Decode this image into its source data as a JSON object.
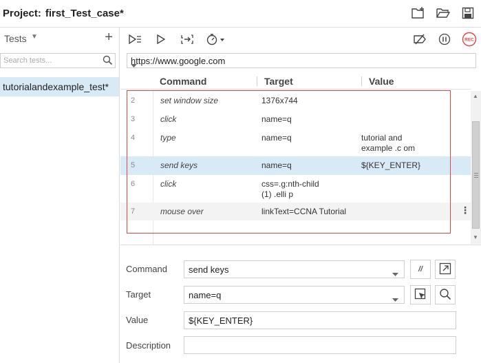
{
  "header": {
    "project_label": "Project:",
    "project_name": "first_Test_case*",
    "icons": [
      "new-folder-icon",
      "open-folder-icon",
      "save-icon"
    ]
  },
  "sidebar": {
    "title": "Tests",
    "add_label": "+",
    "search_placeholder": "Search tests...",
    "tests": [
      {
        "name": "tutorialandexample_test*",
        "selected": true
      }
    ]
  },
  "toolbar": {
    "left_icons": [
      "run-all-icon",
      "run-icon",
      "step-icon",
      "speed-icon"
    ],
    "right_icons": [
      "disable-breakpoints-icon",
      "pause-icon",
      "record-icon"
    ],
    "record_label": "REC"
  },
  "url": {
    "value": "https://www.google.com"
  },
  "table": {
    "columns": [
      "Command",
      "Target",
      "Value"
    ],
    "rows": [
      {
        "num": "2",
        "command": "set window size",
        "target": "1376x744",
        "value": ""
      },
      {
        "num": "3",
        "command": "click",
        "target": "name=q",
        "value": ""
      },
      {
        "num": "4",
        "command": "type",
        "target": "name=q",
        "value": "tutorial and example .c om"
      },
      {
        "num": "5",
        "command": "send keys",
        "target": "name=q",
        "value": "${KEY_ENTER}"
      },
      {
        "num": "6",
        "command": "click",
        "target": "css=.g:nth-child(1) .elli p",
        "value": ""
      },
      {
        "num": "7",
        "command": "mouse over",
        "target": "linkText=CCNA Tutorial",
        "value": ""
      }
    ],
    "selected_row": "5",
    "more_label": "⋮"
  },
  "form": {
    "command_label": "Command",
    "command_value": "send keys",
    "target_label": "Target",
    "target_value": "name=q",
    "value_label": "Value",
    "value_value": "${KEY_ENTER}",
    "description_label": "Description",
    "description_value": "",
    "comment_button_label": "//"
  },
  "colors": {
    "selection": "#d8eaf6",
    "highlight_box": "#e0453f",
    "record": "#e0453f"
  }
}
